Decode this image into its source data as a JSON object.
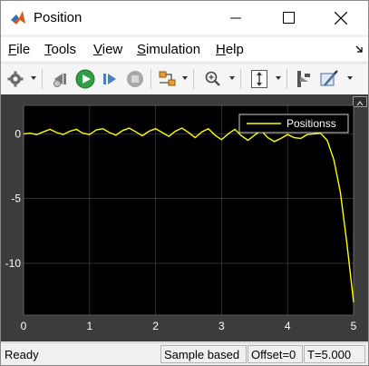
{
  "window": {
    "title": "Position"
  },
  "menu": {
    "items": [
      {
        "label": "File",
        "ul": "F",
        "rest": "ile"
      },
      {
        "label": "Tools",
        "ul": "T",
        "rest": "ools"
      },
      {
        "label": "View",
        "ul": "V",
        "rest": "iew"
      },
      {
        "label": "Simulation",
        "ul": "S",
        "rest": "imulation"
      },
      {
        "label": "Help",
        "ul": "H",
        "rest": "elp"
      }
    ]
  },
  "toolbar": {
    "icons": [
      "gear-icon",
      "step-back-icon",
      "run-icon",
      "step-forward-icon",
      "stop-icon",
      "highlight-model-icon",
      "zoom-icon",
      "autoscale-icon",
      "cursor-measurements-icon",
      "style-icon"
    ]
  },
  "colors": {
    "plot_bg": "#000000",
    "axes_frame": "#3c3c3c",
    "series": "#ffff00",
    "grid": "#808080"
  },
  "chart_data": {
    "type": "line",
    "title": "",
    "xlabel": "",
    "ylabel": "",
    "xlim": [
      0,
      5
    ],
    "ylim": [
      -14,
      2.2
    ],
    "xticks": [
      0,
      1,
      2,
      3,
      4,
      5
    ],
    "xtick_labels": [
      "0",
      "1",
      "2",
      "3",
      "4",
      "5"
    ],
    "yticks": [
      0,
      -5,
      -10
    ],
    "ytick_labels": [
      "0",
      "-5",
      "-10"
    ],
    "grid": true,
    "legend_position": "top-right",
    "series": [
      {
        "name": "Positionss",
        "color": "#ffff00",
        "x": [
          0,
          0.1,
          0.2,
          0.3,
          0.4,
          0.5,
          0.6,
          0.7,
          0.8,
          0.9,
          1.0,
          1.1,
          1.2,
          1.3,
          1.4,
          1.5,
          1.6,
          1.7,
          1.8,
          1.9,
          2.0,
          2.1,
          2.2,
          2.3,
          2.4,
          2.5,
          2.6,
          2.7,
          2.8,
          2.9,
          3.0,
          3.1,
          3.2,
          3.3,
          3.4,
          3.5,
          3.6,
          3.7,
          3.8,
          3.9,
          4.0,
          4.1,
          4.2,
          4.3,
          4.4,
          4.5,
          4.6,
          4.7,
          4.8,
          4.9,
          5.0
        ],
        "y": [
          0,
          0.05,
          -0.05,
          0.15,
          0.35,
          0.1,
          -0.05,
          0.2,
          0.35,
          0.05,
          -0.05,
          0.3,
          0.4,
          0.1,
          -0.1,
          0.25,
          0.45,
          0.15,
          -0.15,
          0.2,
          0.4,
          0.1,
          -0.2,
          0.2,
          0.45,
          0.1,
          -0.3,
          0.15,
          0.4,
          -0.1,
          -0.45,
          0.0,
          0.35,
          -0.15,
          -0.5,
          -0.1,
          0.25,
          -0.3,
          -0.6,
          -0.35,
          -0.05,
          -0.3,
          -0.35,
          -0.05,
          0.0,
          0.05,
          -0.5,
          -2.0,
          -4.5,
          -8.5,
          -13.0
        ]
      }
    ]
  },
  "status": {
    "state": "Ready",
    "mode": "Sample based",
    "offset": "Offset=0",
    "time": "T=5.000"
  }
}
